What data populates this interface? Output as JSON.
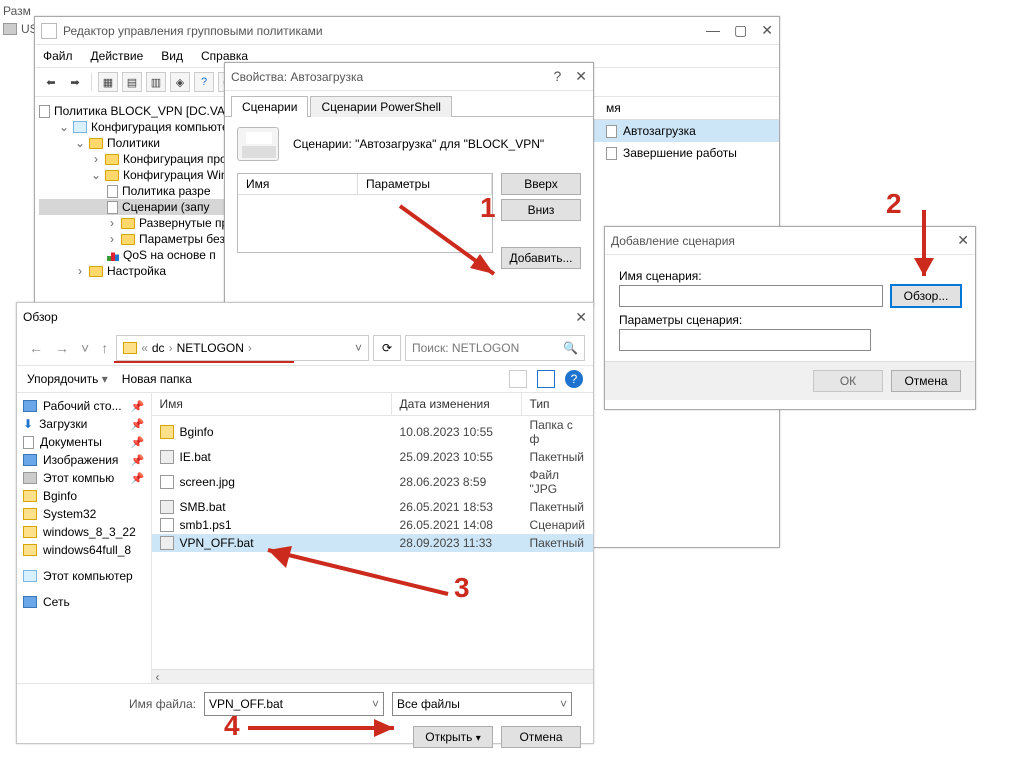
{
  "bg": {
    "line1a": "Разм",
    "line1b": "US"
  },
  "gpmc": {
    "title": "Редактор управления групповыми политиками",
    "menu": [
      "Файл",
      "Действие",
      "Вид",
      "Справка"
    ],
    "tree": {
      "root": "Политика BLOCK_VPN [DC.VA",
      "cfgComputer": "Конфигурация компьютер",
      "policies": "Политики",
      "cfgSoftware": "Конфигурация про",
      "cfgWindows": "Конфигурация Win",
      "polAllow": "Политика разре",
      "scenarios": "Сценарии (запу",
      "deployed": "Развернутые пр",
      "secParams": "Параметры без",
      "qos": "QoS на основе п",
      "settings": "Настройка"
    },
    "rightpane": {
      "colName": "мя",
      "rowStartup": "Автозагрузка",
      "rowShutdown": "Завершение работы"
    }
  },
  "props": {
    "title": "Свойства: Автозагрузка",
    "tabScripts": "Сценарии",
    "tabPS": "Сценарии PowerShell",
    "desc": "Сценарии: \"Автозагрузка\" для \"BLOCK_VPN\"",
    "colName": "Имя",
    "colParams": "Параметры",
    "btnUp": "Вверх",
    "btnDown": "Вниз",
    "btnAdd": "Добавить..."
  },
  "addscript": {
    "title": "Добавление сценария",
    "labelName": "Имя сценария:",
    "labelParams": "Параметры сценария:",
    "btnBrowse": "Обзор...",
    "btnOk": "ОК",
    "btnCancel": "Отмена"
  },
  "open": {
    "title": "Обзор",
    "bc1": "dc",
    "bc2": "NETLOGON",
    "searchPlaceholder": "Поиск: NETLOGON",
    "cmdOrganize": "Упорядочить",
    "cmdNewFolder": "Новая папка",
    "colName": "Имя",
    "colDate": "Дата изменения",
    "colType": "Тип",
    "sidenav": {
      "desktop": "Рабочий сто...",
      "downloads": "Загрузки",
      "documents": "Документы",
      "pictures": "Изображения",
      "thispc": "Этот компью",
      "bginfo": "Bginfo",
      "system32": "System32",
      "win83": "windows_8_3_22",
      "win64": "windows64full_8",
      "thispc2": "Этот компьютер",
      "network": "Сеть"
    },
    "files": [
      {
        "name": "Bginfo",
        "date": "10.08.2023 10:55",
        "type": "Папка с ф",
        "icon": "folder"
      },
      {
        "name": "IE.bat",
        "date": "25.09.2023 10:55",
        "type": "Пакетный",
        "icon": "bat"
      },
      {
        "name": "screen.jpg",
        "date": "28.06.2023 8:59",
        "type": "Файл \"JPG",
        "icon": "doc"
      },
      {
        "name": "SMB.bat",
        "date": "26.05.2021 18:53",
        "type": "Пакетный",
        "icon": "bat"
      },
      {
        "name": "smb1.ps1",
        "date": "26.05.2021 14:08",
        "type": "Сценарий",
        "icon": "doc"
      },
      {
        "name": "VPN_OFF.bat",
        "date": "28.09.2023 11:33",
        "type": "Пакетный",
        "icon": "bat",
        "selected": true
      }
    ],
    "labelFilename": "Имя файла:",
    "filenameValue": "VPN_OFF.bat",
    "filter": "Все файлы",
    "btnOpen": "Открыть",
    "btnCancel": "Отмена"
  },
  "annotations": {
    "n1": "1",
    "n2": "2",
    "n3": "3",
    "n4": "4"
  }
}
